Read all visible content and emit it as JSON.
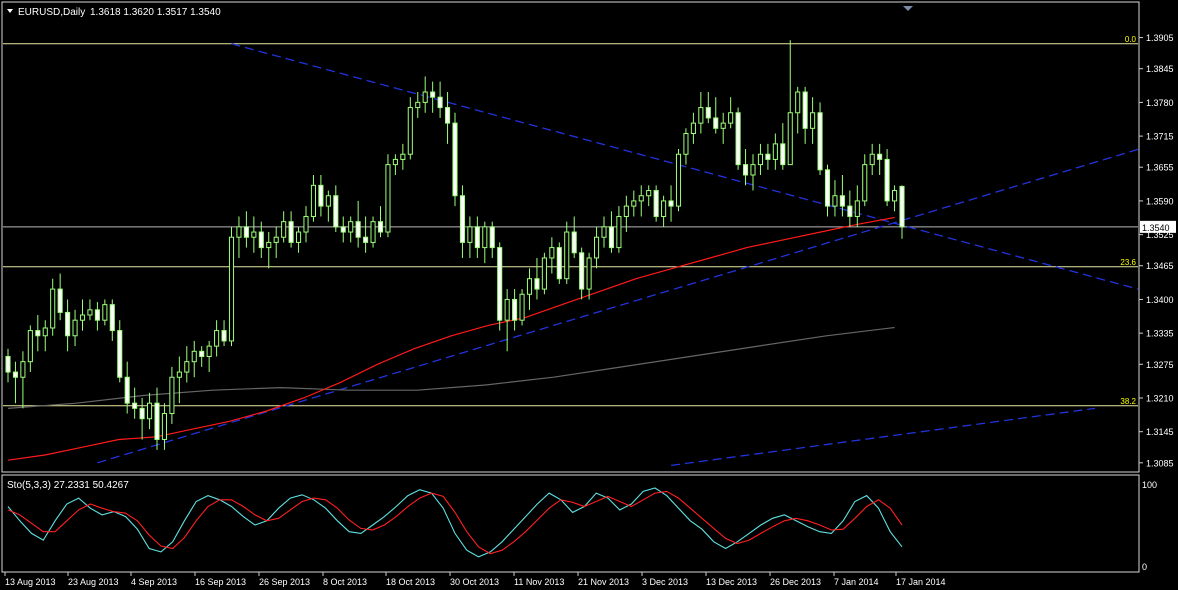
{
  "header": {
    "symbol_label": "EURUSD,Daily",
    "ohlc": "1.3618 1.3620 1.3517 1.3540"
  },
  "indicator": {
    "label": "Sto(5,3,3) 27.2331 50.4267",
    "scale_top": "100",
    "scale_bottom": "0"
  },
  "fib_levels": [
    {
      "label": "0.0",
      "price": 1.3893
    },
    {
      "label": "23.6",
      "price": 1.3463
    },
    {
      "label": "38.2",
      "price": 1.3195
    }
  ],
  "current_price": {
    "label": "1.3540",
    "price": 1.354
  },
  "colors": {
    "background": "#000000",
    "bull_candle": "#d4ffc8",
    "bear_candle": "#ffffff",
    "wick": "#9dff7a",
    "fib_line": "#e8e8a0",
    "trend_line": "#2233dd",
    "ma_fast": "#ff1a1a",
    "ma_slow": "#666666",
    "stoch_main": "#5fe0e0",
    "stoch_signal": "#ff2020",
    "axis_text": "#ffffff",
    "fib_text": "#ffff00"
  },
  "chart_data": {
    "type": "candlestick",
    "y_axis_ticks": [
      "1.3905",
      "1.3845",
      "1.3780",
      "1.3715",
      "1.3655",
      "1.3590",
      "1.3525",
      "1.3465",
      "1.3400",
      "1.3335",
      "1.3275",
      "1.3210",
      "1.3145",
      "1.3085"
    ],
    "ylim": [
      1.3075,
      1.3935
    ],
    "x_axis_ticks": [
      "13 Aug 2013",
      "23 Aug 2013",
      "4 Sep 2013",
      "16 Sep 2013",
      "26 Sep 2013",
      "8 Oct 2013",
      "18 Oct 2013",
      "30 Oct 2013",
      "11 Nov 2013",
      "21 Nov 2013",
      "3 Dec 2013",
      "13 Dec 2013",
      "26 Dec 2013",
      "7 Jan 2014",
      "17 Jan 2014"
    ],
    "candles": [
      [
        1.329,
        1.3305,
        1.324,
        1.326
      ],
      [
        1.326,
        1.328,
        1.32,
        1.325
      ],
      [
        1.325,
        1.33,
        1.319,
        1.328
      ],
      [
        1.328,
        1.335,
        1.326,
        1.334
      ],
      [
        1.334,
        1.337,
        1.33,
        1.333
      ],
      [
        1.333,
        1.336,
        1.33,
        1.3345
      ],
      [
        1.3345,
        1.344,
        1.333,
        1.342
      ],
      [
        1.342,
        1.345,
        1.336,
        1.3375
      ],
      [
        1.3375,
        1.34,
        1.33,
        1.333
      ],
      [
        1.333,
        1.338,
        1.331,
        1.336
      ],
      [
        1.336,
        1.34,
        1.334,
        1.337
      ],
      [
        1.337,
        1.34,
        1.336,
        1.338
      ],
      [
        1.338,
        1.3395,
        1.334,
        1.336
      ],
      [
        1.336,
        1.34,
        1.335,
        1.339
      ],
      [
        1.339,
        1.34,
        1.332,
        1.334
      ],
      [
        1.334,
        1.336,
        1.324,
        1.325
      ],
      [
        1.325,
        1.328,
        1.318,
        1.32
      ],
      [
        1.32,
        1.323,
        1.317,
        1.319
      ],
      [
        1.319,
        1.321,
        1.313,
        1.317
      ],
      [
        1.317,
        1.322,
        1.315,
        1.32
      ],
      [
        1.32,
        1.323,
        1.311,
        1.313
      ],
      [
        1.313,
        1.32,
        1.311,
        1.318
      ],
      [
        1.318,
        1.327,
        1.316,
        1.325
      ],
      [
        1.325,
        1.329,
        1.32,
        1.326
      ],
      [
        1.326,
        1.331,
        1.324,
        1.328
      ],
      [
        1.328,
        1.332,
        1.325,
        1.33
      ],
      [
        1.33,
        1.331,
        1.327,
        1.329
      ],
      [
        1.329,
        1.332,
        1.326,
        1.331
      ],
      [
        1.331,
        1.336,
        1.329,
        1.334
      ],
      [
        1.334,
        1.336,
        1.331,
        1.332
      ],
      [
        1.332,
        1.354,
        1.331,
        1.352
      ],
      [
        1.352,
        1.356,
        1.348,
        1.354
      ],
      [
        1.354,
        1.357,
        1.35,
        1.352
      ],
      [
        1.352,
        1.356,
        1.349,
        1.353
      ],
      [
        1.353,
        1.355,
        1.348,
        1.35
      ],
      [
        1.35,
        1.353,
        1.346,
        1.351
      ],
      [
        1.351,
        1.354,
        1.348,
        1.352
      ],
      [
        1.352,
        1.357,
        1.351,
        1.355
      ],
      [
        1.355,
        1.357,
        1.35,
        1.351
      ],
      [
        1.351,
        1.354,
        1.349,
        1.353
      ],
      [
        1.353,
        1.358,
        1.351,
        1.356
      ],
      [
        1.356,
        1.364,
        1.355,
        1.362
      ],
      [
        1.362,
        1.364,
        1.356,
        1.358
      ],
      [
        1.358,
        1.361,
        1.355,
        1.36
      ],
      [
        1.36,
        1.362,
        1.353,
        1.354
      ],
      [
        1.354,
        1.356,
        1.351,
        1.353
      ],
      [
        1.353,
        1.356,
        1.351,
        1.355
      ],
      [
        1.355,
        1.359,
        1.35,
        1.352
      ],
      [
        1.352,
        1.356,
        1.349,
        1.351
      ],
      [
        1.351,
        1.356,
        1.35,
        1.355
      ],
      [
        1.355,
        1.358,
        1.352,
        1.353
      ],
      [
        1.353,
        1.368,
        1.352,
        1.366
      ],
      [
        1.366,
        1.368,
        1.364,
        1.367
      ],
      [
        1.367,
        1.37,
        1.365,
        1.368
      ],
      [
        1.368,
        1.379,
        1.367,
        1.377
      ],
      [
        1.377,
        1.38,
        1.375,
        1.378
      ],
      [
        1.378,
        1.383,
        1.376,
        1.38
      ],
      [
        1.38,
        1.382,
        1.376,
        1.379
      ],
      [
        1.379,
        1.382,
        1.375,
        1.377
      ],
      [
        1.377,
        1.38,
        1.37,
        1.374
      ],
      [
        1.374,
        1.376,
        1.358,
        1.36
      ],
      [
        1.36,
        1.362,
        1.348,
        1.351
      ],
      [
        1.351,
        1.356,
        1.348,
        1.354
      ],
      [
        1.354,
        1.356,
        1.348,
        1.35
      ],
      [
        1.35,
        1.355,
        1.347,
        1.354
      ],
      [
        1.354,
        1.355,
        1.348,
        1.35
      ],
      [
        1.35,
        1.351,
        1.334,
        1.336
      ],
      [
        1.336,
        1.342,
        1.33,
        1.34
      ],
      [
        1.34,
        1.342,
        1.334,
        1.336
      ],
      [
        1.336,
        1.342,
        1.335,
        1.341
      ],
      [
        1.341,
        1.346,
        1.338,
        1.344
      ],
      [
        1.344,
        1.348,
        1.34,
        1.342
      ],
      [
        1.342,
        1.349,
        1.341,
        1.348
      ],
      [
        1.348,
        1.352,
        1.345,
        1.35
      ],
      [
        1.35,
        1.351,
        1.343,
        1.344
      ],
      [
        1.344,
        1.355,
        1.343,
        1.353
      ],
      [
        1.353,
        1.356,
        1.348,
        1.349
      ],
      [
        1.349,
        1.35,
        1.34,
        1.342
      ],
      [
        1.342,
        1.349,
        1.34,
        1.348
      ],
      [
        1.348,
        1.354,
        1.346,
        1.352
      ],
      [
        1.352,
        1.356,
        1.35,
        1.354
      ],
      [
        1.354,
        1.357,
        1.349,
        1.35
      ],
      [
        1.35,
        1.358,
        1.349,
        1.356
      ],
      [
        1.356,
        1.36,
        1.353,
        1.358
      ],
      [
        1.358,
        1.361,
        1.356,
        1.359
      ],
      [
        1.359,
        1.362,
        1.356,
        1.36
      ],
      [
        1.36,
        1.362,
        1.358,
        1.361
      ],
      [
        1.361,
        1.362,
        1.355,
        1.356
      ],
      [
        1.356,
        1.36,
        1.354,
        1.359
      ],
      [
        1.359,
        1.362,
        1.355,
        1.358
      ],
      [
        1.358,
        1.369,
        1.357,
        1.368
      ],
      [
        1.368,
        1.373,
        1.366,
        1.372
      ],
      [
        1.372,
        1.376,
        1.37,
        1.374
      ],
      [
        1.374,
        1.38,
        1.372,
        1.377
      ],
      [
        1.377,
        1.38,
        1.374,
        1.375
      ],
      [
        1.375,
        1.379,
        1.372,
        1.373
      ],
      [
        1.373,
        1.376,
        1.37,
        1.374
      ],
      [
        1.374,
        1.379,
        1.373,
        1.376
      ],
      [
        1.376,
        1.377,
        1.365,
        1.366
      ],
      [
        1.366,
        1.369,
        1.362,
        1.364
      ],
      [
        1.364,
        1.368,
        1.361,
        1.366
      ],
      [
        1.366,
        1.37,
        1.364,
        1.368
      ],
      [
        1.368,
        1.37,
        1.365,
        1.367
      ],
      [
        1.367,
        1.372,
        1.365,
        1.37
      ],
      [
        1.37,
        1.374,
        1.365,
        1.366
      ],
      [
        1.366,
        1.39,
        1.366,
        1.376
      ],
      [
        1.376,
        1.381,
        1.372,
        1.38
      ],
      [
        1.38,
        1.381,
        1.37,
        1.373
      ],
      [
        1.373,
        1.379,
        1.37,
        1.376
      ],
      [
        1.376,
        1.378,
        1.364,
        1.365
      ],
      [
        1.365,
        1.366,
        1.356,
        1.358
      ],
      [
        1.358,
        1.363,
        1.356,
        1.36
      ],
      [
        1.36,
        1.364,
        1.356,
        1.358
      ],
      [
        1.358,
        1.361,
        1.354,
        1.356
      ],
      [
        1.356,
        1.362,
        1.354,
        1.359
      ],
      [
        1.359,
        1.368,
        1.358,
        1.366
      ],
      [
        1.366,
        1.37,
        1.364,
        1.368
      ],
      [
        1.368,
        1.37,
        1.364,
        1.367
      ],
      [
        1.367,
        1.369,
        1.358,
        1.359
      ],
      [
        1.359,
        1.362,
        1.357,
        1.361
      ],
      [
        1.3618,
        1.362,
        1.3517,
        1.354
      ]
    ],
    "ma_fast": [
      1.309,
      1.31,
      1.3115,
      1.313,
      1.3135,
      1.315,
      1.3165,
      1.3185,
      1.321,
      1.324,
      1.3275,
      1.3305,
      1.333,
      1.335,
      1.3365,
      1.339,
      1.3415,
      1.344,
      1.346,
      1.348,
      1.35,
      1.3515,
      1.353,
      1.3545,
      1.3558
    ],
    "ma_slow": [
      1.319,
      1.32,
      1.3215,
      1.3225,
      1.323,
      1.3225,
      1.3225,
      1.3235,
      1.325,
      1.327,
      1.329,
      1.331,
      1.333,
      1.3346
    ],
    "stoch_main": [
      72,
      55,
      40,
      32,
      55,
      75,
      82,
      70,
      62,
      66,
      60,
      45,
      22,
      18,
      30,
      55,
      78,
      85,
      80,
      72,
      60,
      50,
      55,
      70,
      82,
      86,
      80,
      70,
      55,
      42,
      40,
      50,
      60,
      72,
      85,
      92,
      88,
      70,
      40,
      20,
      12,
      18,
      30,
      45,
      60,
      75,
      88,
      80,
      65,
      72,
      88,
      82,
      68,
      75,
      90,
      94,
      85,
      70,
      55,
      45,
      30,
      22,
      30,
      40,
      50,
      58,
      62,
      55,
      48,
      42,
      40,
      55,
      78,
      85,
      70,
      42,
      24
    ],
    "stoch_signal": [
      68,
      62,
      52,
      42,
      42,
      55,
      68,
      75,
      70,
      66,
      64,
      55,
      38,
      25,
      22,
      35,
      55,
      72,
      80,
      80,
      72,
      62,
      55,
      58,
      68,
      78,
      82,
      80,
      70,
      56,
      46,
      44,
      50,
      60,
      72,
      82,
      88,
      84,
      65,
      42,
      24,
      16,
      20,
      30,
      42,
      56,
      70,
      80,
      77,
      72,
      78,
      84,
      78,
      72,
      80,
      88,
      90,
      82,
      70,
      58,
      46,
      34,
      28,
      32,
      40,
      48,
      55,
      58,
      55,
      50,
      44,
      45,
      58,
      72,
      80,
      70,
      50
    ]
  }
}
